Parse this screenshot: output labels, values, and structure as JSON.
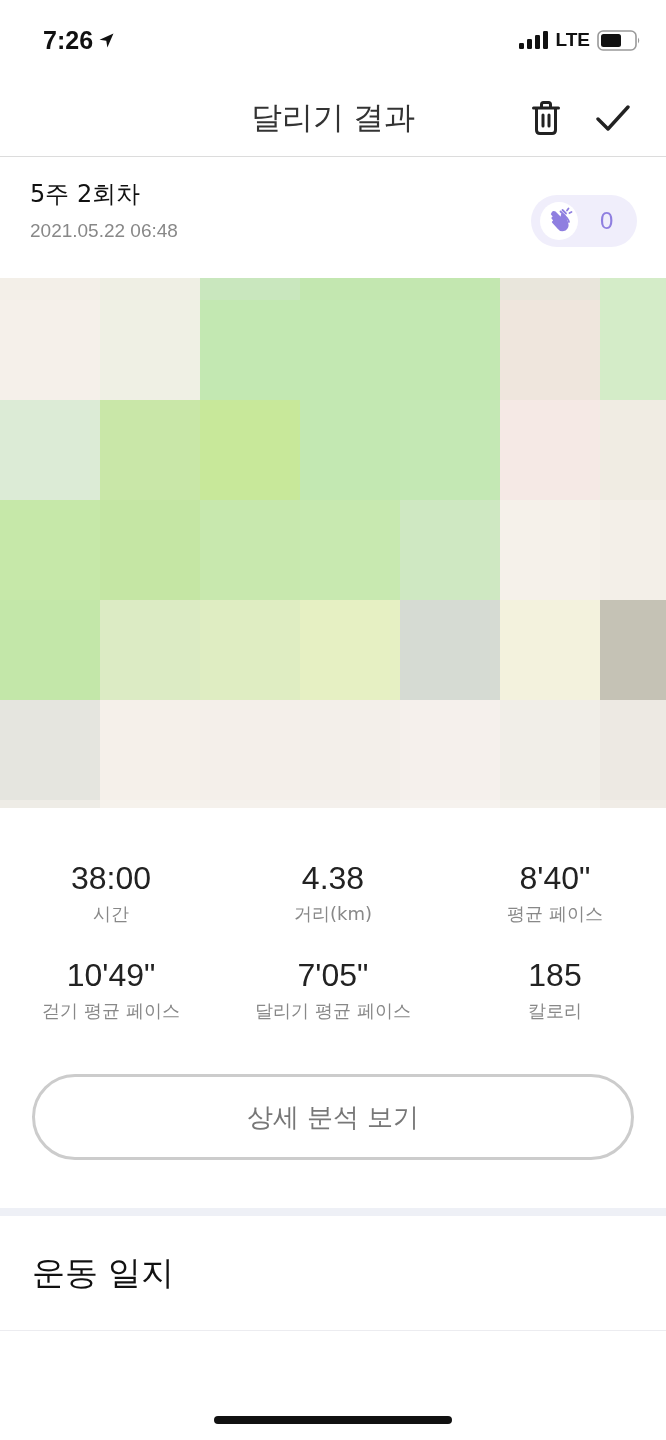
{
  "status_bar": {
    "time": "7:26",
    "network": "LTE"
  },
  "header": {
    "title": "달리기 결과"
  },
  "run": {
    "title": "5주 2회차",
    "datetime": "2021.05.22 06:48",
    "claps": "0"
  },
  "stats": [
    {
      "value": "38:00",
      "label": "시간"
    },
    {
      "value": "4.38",
      "label": "거리(km)"
    },
    {
      "value": "8'40\"",
      "label": "평균 페이스"
    },
    {
      "value": "10'49\"",
      "label": "걷기 평균 페이스"
    },
    {
      "value": "7'05\"",
      "label": "달리기 평균 페이스"
    },
    {
      "value": "185",
      "label": "칼로리"
    }
  ],
  "detail_button": {
    "label": "상세 분석 보기"
  },
  "journal": {
    "title": "운동 일지"
  }
}
